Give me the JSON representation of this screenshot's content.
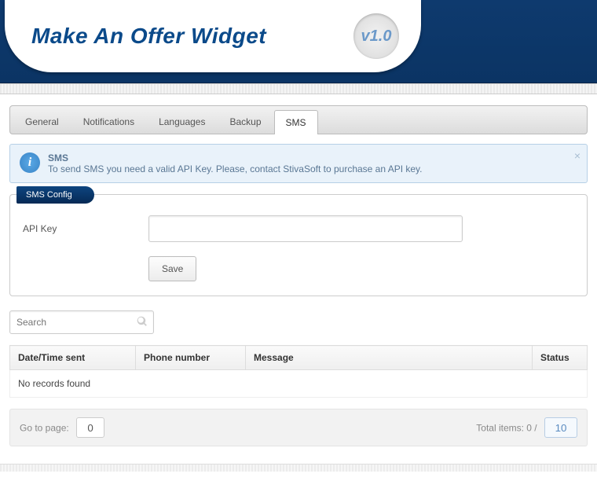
{
  "header": {
    "title": "Make An Offer Widget",
    "version": "v1.0"
  },
  "tabs": [
    {
      "label": "General"
    },
    {
      "label": "Notifications"
    },
    {
      "label": "Languages"
    },
    {
      "label": "Backup"
    },
    {
      "label": "SMS",
      "active": true
    }
  ],
  "info": {
    "title": "SMS",
    "body": "To send SMS you need a valid API Key. Please, contact StivaSoft to purchase an API key.",
    "close": "×"
  },
  "sms_config": {
    "legend": "SMS Config",
    "api_key_label": "API Key",
    "api_key_value": "",
    "save_label": "Save"
  },
  "search": {
    "placeholder": "Search"
  },
  "table": {
    "columns": [
      "Date/Time sent",
      "Phone number",
      "Message",
      "Status"
    ],
    "empty": "No records found"
  },
  "pager": {
    "goto_label": "Go to page:",
    "page": "0",
    "total_label": "Total items: 0 /",
    "per_page": "10"
  }
}
